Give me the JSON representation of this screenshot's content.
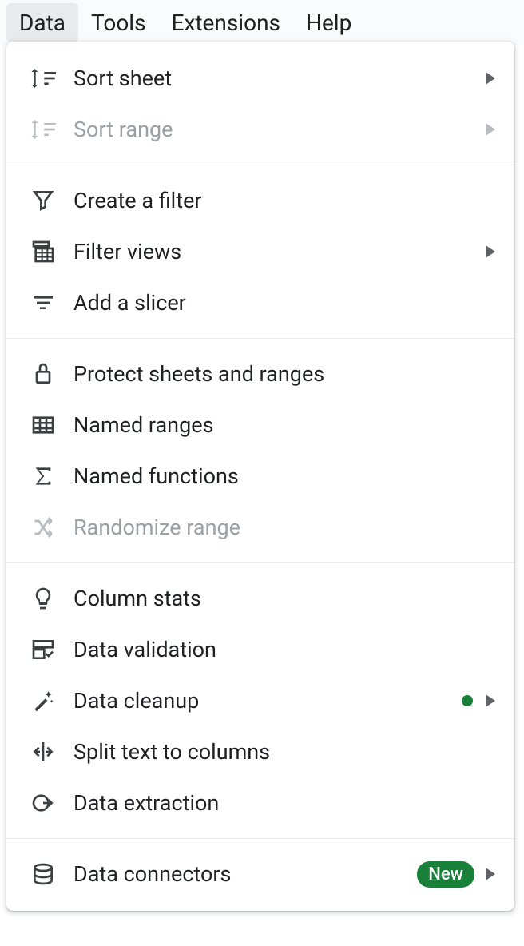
{
  "menubar": {
    "data": "Data",
    "tools": "Tools",
    "extensions": "Extensions",
    "help": "Help"
  },
  "menu": {
    "sort_sheet": "Sort sheet",
    "sort_range": "Sort range",
    "create_filter": "Create a filter",
    "filter_views": "Filter views",
    "add_slicer": "Add a slicer",
    "protect_sheets": "Protect sheets and ranges",
    "named_ranges": "Named ranges",
    "named_functions": "Named functions",
    "randomize_range": "Randomize range",
    "column_stats": "Column stats",
    "data_validation": "Data validation",
    "data_cleanup": "Data cleanup",
    "split_text": "Split text to columns",
    "data_extraction": "Data extraction",
    "data_connectors": "Data connectors",
    "new_badge": "New"
  }
}
